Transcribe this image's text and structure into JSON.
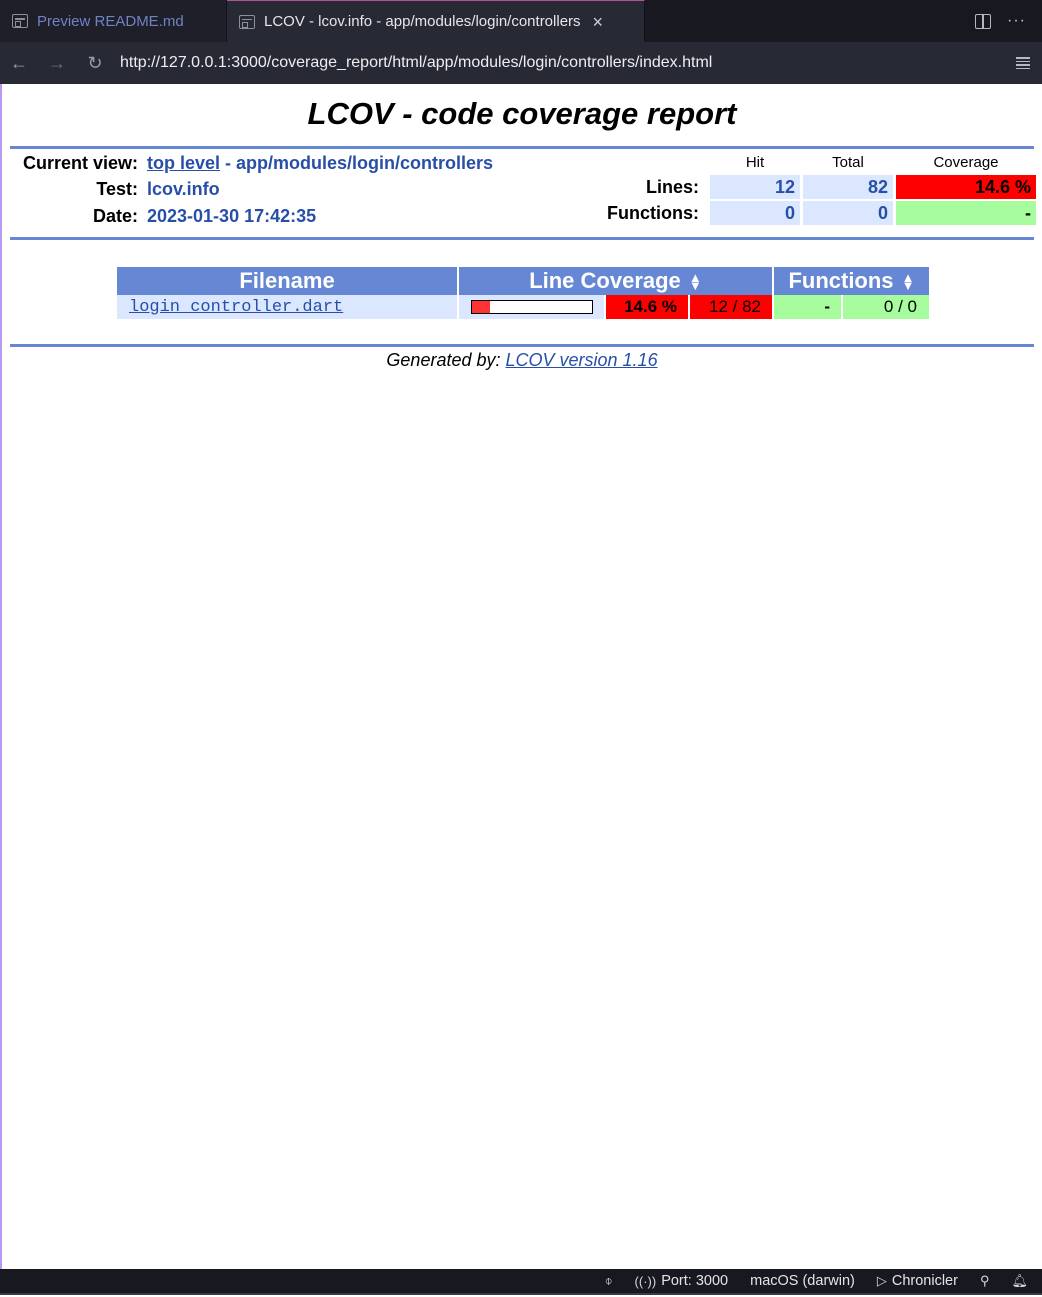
{
  "tabs": [
    {
      "label": "Preview README.md",
      "active": false,
      "icon": "preview-icon"
    },
    {
      "label": "LCOV - lcov.info - app/modules/login/controllers",
      "active": true,
      "icon": "preview-icon",
      "close_icon": "close-icon"
    }
  ],
  "tab_actions": {
    "split_icon": "split-editor-icon",
    "more_icon": "more-actions-icon",
    "more_glyph": "···",
    "close_glyph": "×"
  },
  "addressbar": {
    "back_glyph": "←",
    "forward_glyph": "→",
    "reload_glyph": "↻",
    "url": "http://127.0.0.1:3000/coverage_report/html/app/modules/login/controllers/index.html"
  },
  "report": {
    "title": "LCOV - code coverage report",
    "current_view_label": "Current view:",
    "current_view_link": "top level",
    "current_view_path": " - app/modules/login/controllers",
    "test_label": "Test:",
    "test_value": "lcov.info",
    "date_label": "Date:",
    "date_value": "2023-01-30 17:42:35",
    "summary": {
      "headers": {
        "hit": "Hit",
        "total": "Total",
        "coverage": "Coverage"
      },
      "lines": {
        "label": "Lines:",
        "hit": "12",
        "total": "82",
        "coverage": "14.6 %",
        "status_color": "#ff0000"
      },
      "functions": {
        "label": "Functions:",
        "hit": "0",
        "total": "0",
        "coverage": "-",
        "status_color": "#a7fc9d"
      }
    },
    "table": {
      "headers": {
        "filename": "Filename",
        "line_coverage": "Line Coverage",
        "functions": "Functions",
        "sort_glyph": "⬍"
      },
      "rows": [
        {
          "filename": "login_controller.dart",
          "line_coverage_fraction": 0.146,
          "line_pct": "14.6 %",
          "line_ratio": "12 / 82",
          "func_pct": "-",
          "func_ratio": "0 / 0"
        }
      ]
    },
    "footer": {
      "prefix": "Generated by: ",
      "link": "LCOV version 1.16"
    }
  },
  "statusbar": {
    "items": [
      {
        "icon": "git-commit-icon",
        "glyph": "⌽",
        "label": ""
      },
      {
        "icon": "broadcast-icon",
        "glyph": "((·))",
        "label": "Port: 3000"
      },
      {
        "icon": "",
        "glyph": "",
        "label": "macOS (darwin)"
      },
      {
        "icon": "play-icon",
        "glyph": "▷",
        "label": "Chronicler"
      },
      {
        "icon": "feedback-icon",
        "glyph": "⚲",
        "label": ""
      },
      {
        "icon": "notification-bell-icon",
        "glyph": "🔔︎",
        "label": ""
      }
    ]
  },
  "colors": {
    "header_blue": "#6688d4",
    "cell_blue": "#dae7fe",
    "link_blue": "#284fa8",
    "low_red": "#ff0000",
    "high_green": "#a7fc9d",
    "bar_red": "#ff3333"
  }
}
